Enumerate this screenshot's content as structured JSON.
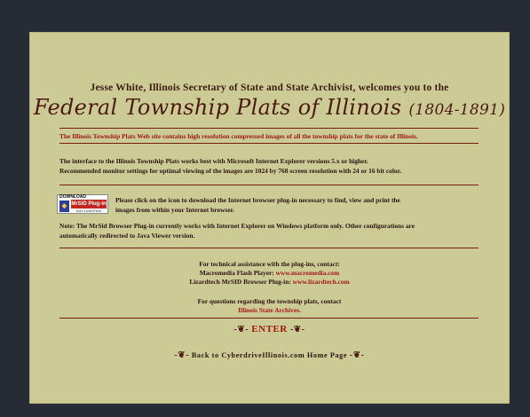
{
  "header": {
    "welcome": "Jesse White, Illinois Secretary of State and State Archivist, welcomes you to the",
    "title": "Federal Township Plats of Illinois",
    "years": "(1804-1891)"
  },
  "intro_note": "The Illinois Township Plats Web site contains high resolution compressed images of all the township plats for the state of Illinois.",
  "browser_info": {
    "line1": "The interface to the Illinois Township Plats works best with Microsoft Internet Explorer versions 5.x or higher.",
    "line2": "Recommended monitor settings for optimal viewing of the images are 1024 by 768 screen resolution with 24 or 16 bit color."
  },
  "plugin": {
    "badge_download": "DOWNLOAD",
    "badge_name": "MrSID Plug-in",
    "badge_from": "from LizardTech",
    "text_line1": "Please click on the icon to download the Internet browser plug-in necessary to find, view and print the",
    "text_line2": "images from within your Internet browser."
  },
  "note": {
    "line1": "Note: The MrSid Browser Plug-in currently works with Internet Explorer on Windows platform only. Other configurations are",
    "line2": "automatically redirected to Java Viewer version."
  },
  "support": {
    "heading": "For technical assistance with the plug-ins, contact:",
    "flash_label": "Macromedia Flash Player: ",
    "flash_link": "www.macromedia.com",
    "lizard_label": "Lizardtech MrSID Browser Plug-in: ",
    "lizard_link": "www.lizardtech.com",
    "questions": "For questions regarding the township plats, contact",
    "archives_link": "Illinois State Archives."
  },
  "nav": {
    "enter": "ENTER",
    "back": "Back to CyberdriveIllinois.com Home Page",
    "flourish_left": "-❦-",
    "flourish_right": "-❦-"
  },
  "colors": {
    "background": "#262b36",
    "panel": "#cdcb95",
    "accent": "#9a1a10"
  }
}
